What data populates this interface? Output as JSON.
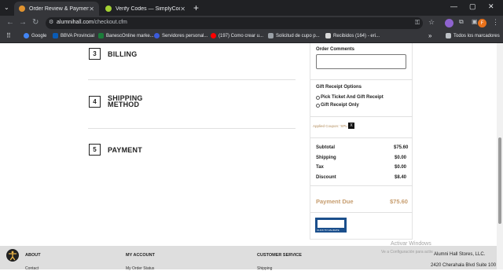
{
  "browser": {
    "tabs": [
      {
        "title": "Order Review & Payment | Alun",
        "active": true,
        "favicon_color": "#e0932f"
      },
      {
        "title": "Verify Codes — SimplyCodes",
        "active": false,
        "favicon_color": "#a4d233"
      }
    ],
    "new_tab": "+",
    "url_host": "alumnihall.com",
    "url_path": "/checkout.cfm",
    "bookmarks": [
      {
        "label": "Google",
        "color": "#4285f4"
      },
      {
        "label": "BBVA Provincial",
        "color": "#0a5bb5"
      },
      {
        "label": "BanescOnline marke...",
        "color": "#1b7d3a"
      },
      {
        "label": "Servidores personal...",
        "color": "#3b5bdb"
      },
      {
        "label": "(197) Como crear u...",
        "color": "#ff0000"
      },
      {
        "label": "Solicitud de cupo p...",
        "color": "#9aa0a6"
      },
      {
        "label": "Recibidos (164) - eri...",
        "color": "#d9d9d9"
      }
    ],
    "bookmarks_more": "»",
    "all_bookmarks": "Todos los marcadores",
    "profile_initial": "F"
  },
  "steps": [
    {
      "number": "3",
      "label": "BILLING"
    },
    {
      "number": "4",
      "label": "SHIPPING METHOD"
    },
    {
      "number": "5",
      "label": "PAYMENT"
    }
  ],
  "order": {
    "comments_label": "Order Comments",
    "gift_receipt_label": "Gift Receipt Options",
    "gift_options": [
      "Pick Ticket And Gift Receipt",
      "Gift Receipt Only"
    ],
    "coupon_text": "Applied Coupon: 'SPL10'",
    "coupon_remove": "X",
    "totals": [
      {
        "label": "Subtotal",
        "value": "$75.60"
      },
      {
        "label": "Shipping",
        "value": "$0.00"
      },
      {
        "label": "Tax",
        "value": "$0.00"
      },
      {
        "label": "Discount",
        "value": "$8.40"
      }
    ],
    "payment_due_label": "Payment Due",
    "payment_due_value": "$75.60",
    "badge_text": "CLICK TO VALIDATE"
  },
  "footer": {
    "about": "ABOUT",
    "about_link": "Contact",
    "my_account": "MY ACCOUNT",
    "my_account_link": "My Order Status",
    "customer_service": "CUSTOMER SERVICE",
    "customer_service_link": "Shipping",
    "company_name": "Alumni Hall Stores, LLC.",
    "company_address": "2420 Cherahala Blvd Suite 100"
  },
  "watermark": {
    "line1": "Activar Windows",
    "line2": "Ve a Configuración para activar Windows."
  }
}
